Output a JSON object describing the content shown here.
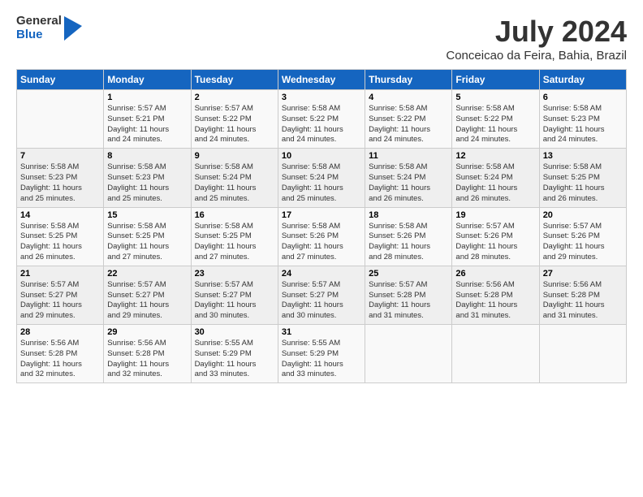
{
  "logo": {
    "line1": "General",
    "line2": "Blue"
  },
  "title": "July 2024",
  "subtitle": "Conceicao da Feira, Bahia, Brazil",
  "days_header": [
    "Sunday",
    "Monday",
    "Tuesday",
    "Wednesday",
    "Thursday",
    "Friday",
    "Saturday"
  ],
  "weeks": [
    [
      {
        "day": "",
        "text": ""
      },
      {
        "day": "1",
        "text": "Sunrise: 5:57 AM\nSunset: 5:21 PM\nDaylight: 11 hours\nand 24 minutes."
      },
      {
        "day": "2",
        "text": "Sunrise: 5:57 AM\nSunset: 5:22 PM\nDaylight: 11 hours\nand 24 minutes."
      },
      {
        "day": "3",
        "text": "Sunrise: 5:58 AM\nSunset: 5:22 PM\nDaylight: 11 hours\nand 24 minutes."
      },
      {
        "day": "4",
        "text": "Sunrise: 5:58 AM\nSunset: 5:22 PM\nDaylight: 11 hours\nand 24 minutes."
      },
      {
        "day": "5",
        "text": "Sunrise: 5:58 AM\nSunset: 5:22 PM\nDaylight: 11 hours\nand 24 minutes."
      },
      {
        "day": "6",
        "text": "Sunrise: 5:58 AM\nSunset: 5:23 PM\nDaylight: 11 hours\nand 24 minutes."
      }
    ],
    [
      {
        "day": "7",
        "text": "Sunrise: 5:58 AM\nSunset: 5:23 PM\nDaylight: 11 hours\nand 25 minutes."
      },
      {
        "day": "8",
        "text": "Sunrise: 5:58 AM\nSunset: 5:23 PM\nDaylight: 11 hours\nand 25 minutes."
      },
      {
        "day": "9",
        "text": "Sunrise: 5:58 AM\nSunset: 5:24 PM\nDaylight: 11 hours\nand 25 minutes."
      },
      {
        "day": "10",
        "text": "Sunrise: 5:58 AM\nSunset: 5:24 PM\nDaylight: 11 hours\nand 25 minutes."
      },
      {
        "day": "11",
        "text": "Sunrise: 5:58 AM\nSunset: 5:24 PM\nDaylight: 11 hours\nand 26 minutes."
      },
      {
        "day": "12",
        "text": "Sunrise: 5:58 AM\nSunset: 5:24 PM\nDaylight: 11 hours\nand 26 minutes."
      },
      {
        "day": "13",
        "text": "Sunrise: 5:58 AM\nSunset: 5:25 PM\nDaylight: 11 hours\nand 26 minutes."
      }
    ],
    [
      {
        "day": "14",
        "text": "Sunrise: 5:58 AM\nSunset: 5:25 PM\nDaylight: 11 hours\nand 26 minutes."
      },
      {
        "day": "15",
        "text": "Sunrise: 5:58 AM\nSunset: 5:25 PM\nDaylight: 11 hours\nand 27 minutes."
      },
      {
        "day": "16",
        "text": "Sunrise: 5:58 AM\nSunset: 5:25 PM\nDaylight: 11 hours\nand 27 minutes."
      },
      {
        "day": "17",
        "text": "Sunrise: 5:58 AM\nSunset: 5:26 PM\nDaylight: 11 hours\nand 27 minutes."
      },
      {
        "day": "18",
        "text": "Sunrise: 5:58 AM\nSunset: 5:26 PM\nDaylight: 11 hours\nand 28 minutes."
      },
      {
        "day": "19",
        "text": "Sunrise: 5:57 AM\nSunset: 5:26 PM\nDaylight: 11 hours\nand 28 minutes."
      },
      {
        "day": "20",
        "text": "Sunrise: 5:57 AM\nSunset: 5:26 PM\nDaylight: 11 hours\nand 29 minutes."
      }
    ],
    [
      {
        "day": "21",
        "text": "Sunrise: 5:57 AM\nSunset: 5:27 PM\nDaylight: 11 hours\nand 29 minutes."
      },
      {
        "day": "22",
        "text": "Sunrise: 5:57 AM\nSunset: 5:27 PM\nDaylight: 11 hours\nand 29 minutes."
      },
      {
        "day": "23",
        "text": "Sunrise: 5:57 AM\nSunset: 5:27 PM\nDaylight: 11 hours\nand 30 minutes."
      },
      {
        "day": "24",
        "text": "Sunrise: 5:57 AM\nSunset: 5:27 PM\nDaylight: 11 hours\nand 30 minutes."
      },
      {
        "day": "25",
        "text": "Sunrise: 5:57 AM\nSunset: 5:28 PM\nDaylight: 11 hours\nand 31 minutes."
      },
      {
        "day": "26",
        "text": "Sunrise: 5:56 AM\nSunset: 5:28 PM\nDaylight: 11 hours\nand 31 minutes."
      },
      {
        "day": "27",
        "text": "Sunrise: 5:56 AM\nSunset: 5:28 PM\nDaylight: 11 hours\nand 31 minutes."
      }
    ],
    [
      {
        "day": "28",
        "text": "Sunrise: 5:56 AM\nSunset: 5:28 PM\nDaylight: 11 hours\nand 32 minutes."
      },
      {
        "day": "29",
        "text": "Sunrise: 5:56 AM\nSunset: 5:28 PM\nDaylight: 11 hours\nand 32 minutes."
      },
      {
        "day": "30",
        "text": "Sunrise: 5:55 AM\nSunset: 5:29 PM\nDaylight: 11 hours\nand 33 minutes."
      },
      {
        "day": "31",
        "text": "Sunrise: 5:55 AM\nSunset: 5:29 PM\nDaylight: 11 hours\nand 33 minutes."
      },
      {
        "day": "",
        "text": ""
      },
      {
        "day": "",
        "text": ""
      },
      {
        "day": "",
        "text": ""
      }
    ]
  ]
}
